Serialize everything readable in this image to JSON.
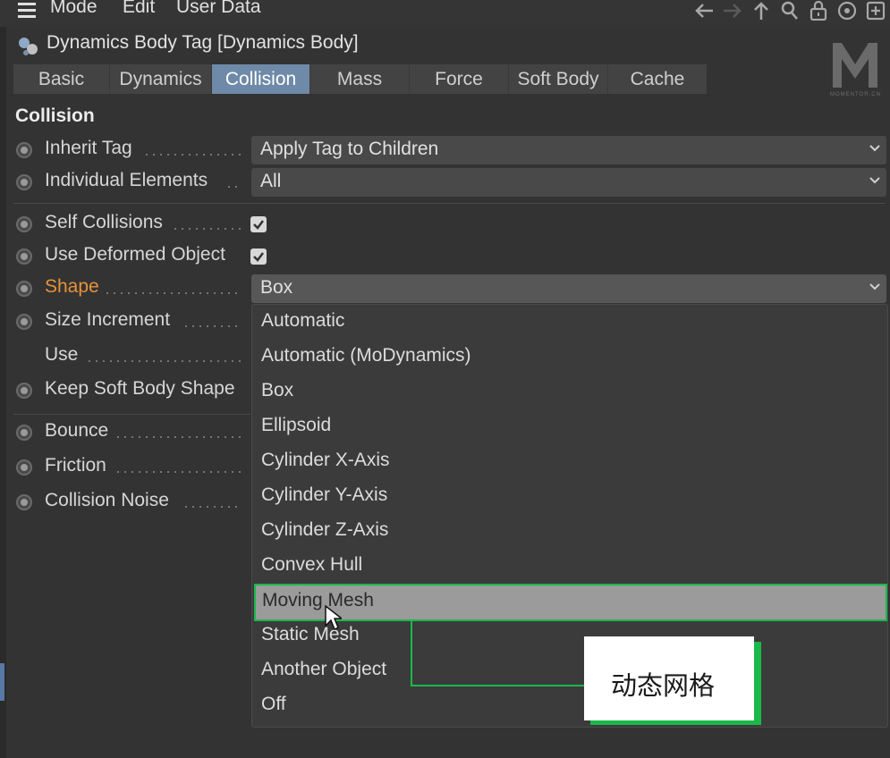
{
  "menu": {
    "items": [
      "Mode",
      "Edit",
      "User Data"
    ],
    "icons": [
      "back-arrow-icon",
      "forward-arrow-icon",
      "up-arrow-icon",
      "search-icon",
      "lock-icon",
      "target-icon",
      "add-icon"
    ]
  },
  "title": "Dynamics Body Tag [Dynamics Body]",
  "logo": {
    "letter": "M",
    "sub": "MOMENTOR.CN"
  },
  "tabs": [
    {
      "label": "Basic"
    },
    {
      "label": "Dynamics"
    },
    {
      "label": "Collision",
      "active": true
    },
    {
      "label": "Mass"
    },
    {
      "label": "Force"
    },
    {
      "label": "Soft Body"
    },
    {
      "label": "Cache"
    }
  ],
  "section": "Collision",
  "fields": {
    "inherit_tag": {
      "label": "Inherit Tag",
      "value": "Apply Tag to Children"
    },
    "individual_elements": {
      "label": "Individual Elements",
      "value": "All"
    },
    "self_collisions": {
      "label": "Self Collisions",
      "checked": true
    },
    "use_deformed_object": {
      "label": "Use Deformed Object",
      "checked": true
    },
    "shape": {
      "label": "Shape",
      "value": "Box"
    },
    "size_increment": {
      "label": "Size Increment"
    },
    "use": {
      "label": "Use"
    },
    "keep_soft_body_shape": {
      "label": "Keep Soft Body Shape"
    },
    "bounce": {
      "label": "Bounce"
    },
    "friction": {
      "label": "Friction"
    },
    "collision_noise": {
      "label": "Collision Noise"
    }
  },
  "shape_options": [
    "Automatic",
    "Automatic (MoDynamics)",
    "Box",
    "Ellipsoid",
    "Cylinder X-Axis",
    "Cylinder Y-Axis",
    "Cylinder Z-Axis",
    "Convex Hull",
    "Moving Mesh",
    "Static Mesh",
    "Another Object",
    "Off"
  ],
  "highlighted_option": "Moving Mesh",
  "annotation": {
    "text": "动态网格"
  },
  "colors": {
    "accent": "#e8923a",
    "active_tab": "#6e8aa8",
    "annotation": "#1bb84a"
  }
}
